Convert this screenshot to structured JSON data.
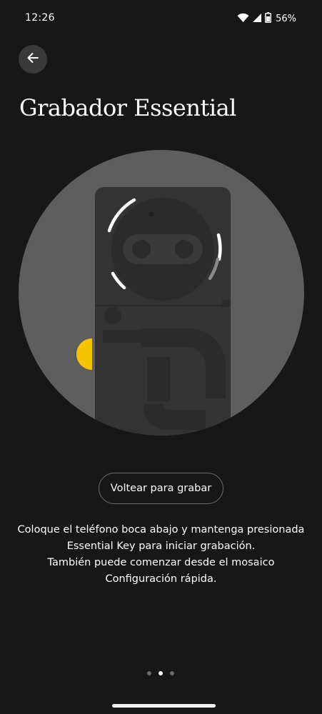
{
  "status_bar": {
    "time": "12:26",
    "battery_percent": "56%",
    "icons": [
      "wifi-icon",
      "signal-icon",
      "battery-icon"
    ]
  },
  "header": {
    "back_icon": "arrow-left-icon",
    "title": "Grabador Essential"
  },
  "illustration": {
    "description_icon": "phone-back-flip-illustration",
    "key_color": "#F5C400",
    "circle_color": "#5e5e5e",
    "phone_color": "#333333"
  },
  "action": {
    "flip_button_label": "Voltear para grabar"
  },
  "instructions": {
    "line1": "Coloque el teléfono boca abajo y mantenga presionada",
    "line2": "Essential Key para iniciar grabación.",
    "line3": "También puede comenzar desde el mosaico",
    "line4": "Configuración rápida."
  },
  "pager": {
    "total": 3,
    "active_index": 1
  },
  "colors": {
    "background": "#171717",
    "text": "#ffffff",
    "accent": "#F5C400"
  }
}
